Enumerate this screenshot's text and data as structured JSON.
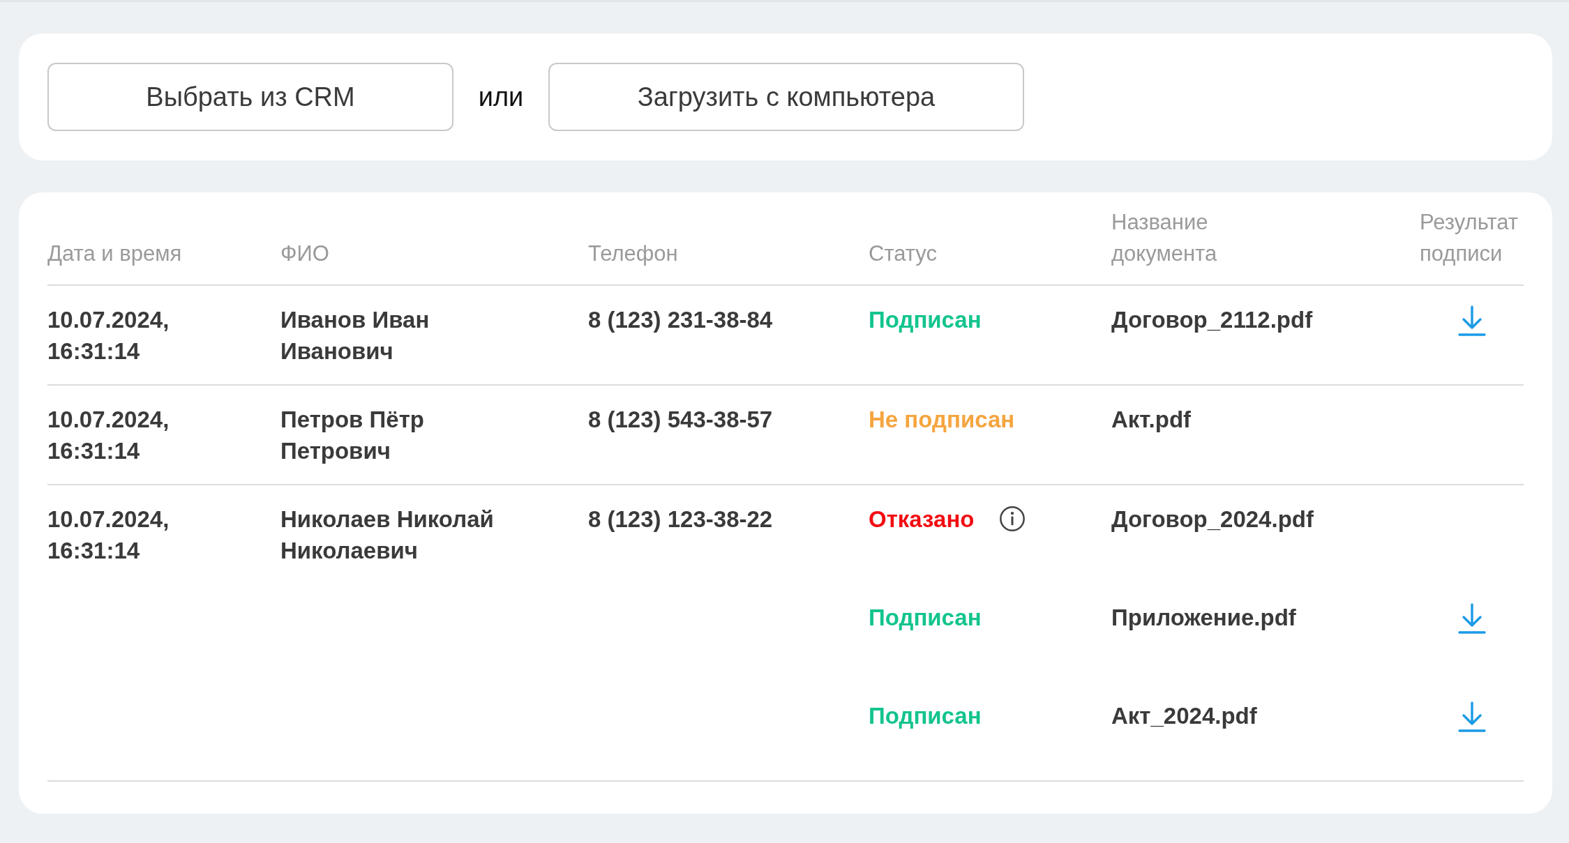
{
  "actions": {
    "buttons": [
      "Выбрать из CRM",
      "Загрузить с компьютера"
    ],
    "separator": "или"
  },
  "table": {
    "columns": [
      "Дата и время",
      "ФИО",
      "Телефон",
      "Статус",
      "Название документа",
      "Результат подписи"
    ],
    "rows": [
      {
        "datetime": "10.07.2024, 16:31:14",
        "name": "Иванов Иван Иванович",
        "phone": "8 (123) 231-38-84",
        "documents": [
          {
            "status": "Подписан",
            "color": "#12c48e",
            "info": false,
            "file": "Договор_2112.pdf",
            "download": true
          }
        ]
      },
      {
        "datetime": "10.07.2024, 16:31:14",
        "name": "Петров Пётр Петрович",
        "phone": "8 (123) 543-38-57",
        "documents": [
          {
            "status": "Не подписан",
            "color": "#f5a53f",
            "info": false,
            "file": "Акт.pdf",
            "download": false
          }
        ]
      },
      {
        "datetime": "10.07.2024, 16:31:14",
        "name": "Николаев Николай Николаевич",
        "phone": "8 (123) 123-38-22",
        "documents": [
          {
            "status": "Отказано",
            "color": "#f20d12",
            "info": true,
            "file": "Договор_2024.pdf",
            "download": false
          },
          {
            "status": "Подписан",
            "color": "#12c48e",
            "info": false,
            "file": "Приложение.pdf",
            "download": true
          },
          {
            "status": "Подписан",
            "color": "#12c48e",
            "info": false,
            "file": "Акт_2024.pdf",
            "download": true
          }
        ]
      }
    ]
  }
}
